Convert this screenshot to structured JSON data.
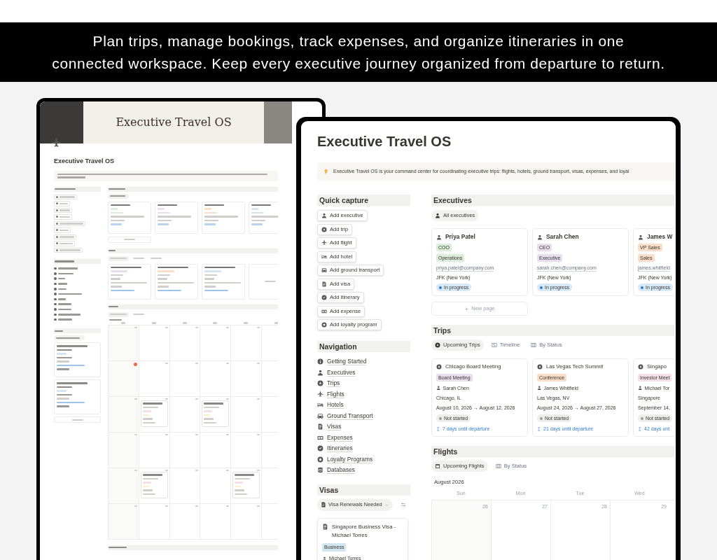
{
  "headline_lines": [
    "Plan trips, manage bookings, track expenses, and organize itineraries in one",
    "connected workspace. Keep every executive journey organized from departure to return."
  ],
  "preview": {
    "banner_title": "Executive Travel OS",
    "title": "Executive Travel OS"
  },
  "main": {
    "title": "Executive Travel OS",
    "callout": "Executive Travel OS is your command center for coordinating executive trips: flights, hotels, ground transport, visas, expenses, and loyal",
    "quick_capture": {
      "title": "Quick capture",
      "buttons": [
        "Add executive",
        "Add trip",
        "Add flight",
        "Add hotel",
        "Add ground transport",
        "Add visa",
        "Add itinerary",
        "Add expense",
        "Add loyalty program"
      ]
    },
    "navigation": {
      "title": "Navigation",
      "items": [
        "Getting Started",
        "Executives",
        "Trips",
        "Flights",
        "Hotels",
        "Ground Transport",
        "Visas",
        "Expenses",
        "Itineraries",
        "Loyalty Programs",
        "Databases"
      ]
    },
    "visas": {
      "title": "Visas",
      "view": "Visa Renewals Needed",
      "cards": [
        {
          "title": "Singapore Business Visa - Michael Torres",
          "tag": {
            "text": "Business",
            "color": "#d3e5ef"
          },
          "person": "Michael Torres"
        }
      ]
    },
    "executives": {
      "title": "Executives",
      "view": "All executives",
      "cards": [
        {
          "name": "Priya Patel",
          "role": {
            "text": "COO",
            "color": "#dbeddb"
          },
          "dept": {
            "text": "Operations",
            "color": "#dbeddb"
          },
          "email": "priya.patel@company.com",
          "airport": "JFK (New York)",
          "status": {
            "text": "In progress",
            "color": "#2e7dd1"
          }
        },
        {
          "name": "Sarah Chen",
          "role": {
            "text": "CEO",
            "color": "#e8deee"
          },
          "dept": {
            "text": "Executive",
            "color": "#e8deee"
          },
          "email": "sarah.chen@company.com",
          "airport": "JFK (New York)",
          "status": {
            "text": "In progress",
            "color": "#2e7dd1"
          }
        },
        {
          "name": "James W",
          "role": {
            "text": "VP Sales",
            "color": "#fadec9"
          },
          "dept": {
            "text": "Sales",
            "color": "#fadec9"
          },
          "email": "james.whitfield",
          "airport": "JFK (New York)",
          "status": {
            "text": "In progress",
            "color": "#2e7dd1"
          }
        }
      ],
      "new_page": "New page"
    },
    "trips": {
      "title": "Trips",
      "views": [
        {
          "label": "Upcoming Trips",
          "selected": true
        },
        {
          "label": "Timeline",
          "selected": false
        },
        {
          "label": "By Status",
          "selected": false
        }
      ],
      "cards": [
        {
          "name": "Chicago Board Meeting",
          "tag": {
            "text": "Board Meeting",
            "color": "#e8deee"
          },
          "person": "Sarah Chen",
          "place": "Chicago, IL",
          "dates": "August 10, 2026 → August 12, 2026",
          "status": {
            "text": "Not started",
            "color": "#9b9a97"
          },
          "countdown": "7 days until departure"
        },
        {
          "name": "Las Vegas Tech Summit",
          "tag": {
            "text": "Conference",
            "color": "#fadec9"
          },
          "person": "James Whitfield",
          "place": "Las Vegas, NV",
          "dates": "August 24, 2026 → August 27, 2026",
          "status": {
            "text": "Not started",
            "color": "#9b9a97"
          },
          "countdown": "21 days until departure"
        },
        {
          "name": "Singapo",
          "tag": {
            "text": "Investor Meet",
            "color": "#f5e0e9"
          },
          "person": "Michael Tor",
          "place": "Singapore",
          "dates": "September 14,",
          "status": {
            "text": "Not started",
            "color": "#9b9a97"
          },
          "countdown": "42 days unt"
        }
      ]
    },
    "flights": {
      "title": "Flights",
      "views": [
        {
          "label": "Upcoming Flights",
          "selected": true
        },
        {
          "label": "By Status",
          "selected": false
        }
      ],
      "month": "August 2026",
      "weekdays": [
        "Sun",
        "Mon",
        "Tue",
        "Wed"
      ],
      "dates": [
        {
          "day": "26",
          "today": false
        },
        {
          "day": "27",
          "today": false
        },
        {
          "day": "28",
          "today": false
        },
        {
          "day": "29",
          "today": false
        }
      ]
    }
  }
}
